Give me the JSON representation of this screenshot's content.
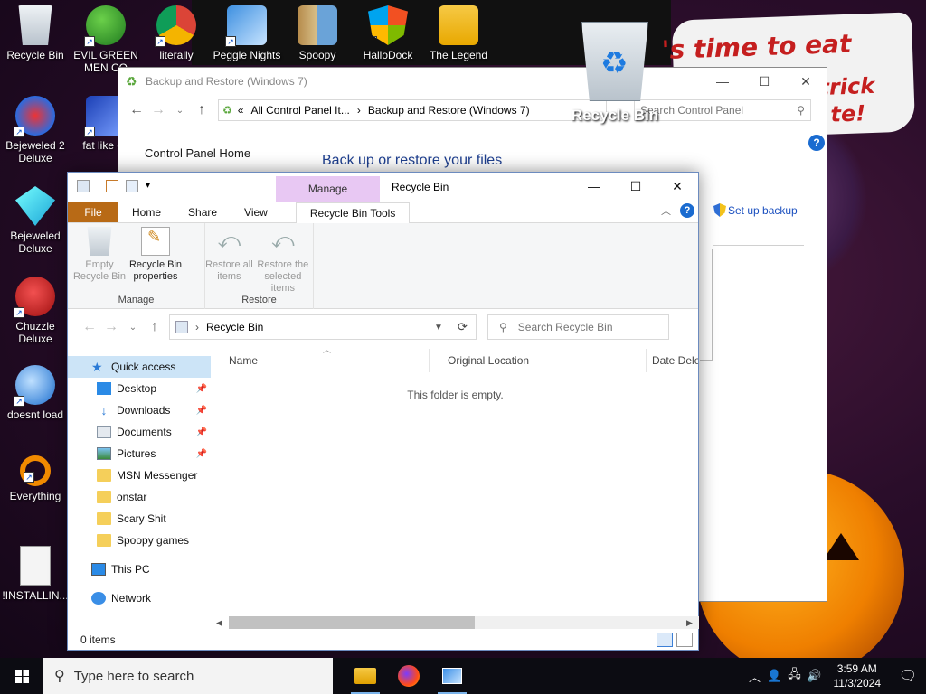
{
  "desktop": {
    "icons": [
      {
        "label": "Recycle Bin"
      },
      {
        "label": "EVIL GREEN MEN CO"
      },
      {
        "label": "literally"
      },
      {
        "label": "Peggle Nights"
      },
      {
        "label": "Spoopy"
      },
      {
        "label": "HalloDock"
      },
      {
        "label": "The Legend"
      },
      {
        "label": "Bejeweled 2 Deluxe"
      },
      {
        "label": "fat like da"
      },
      {
        "label": "Bejeweled Deluxe"
      },
      {
        "label": "Chuzzle Deluxe"
      },
      {
        "label": "doesnt load"
      },
      {
        "label": "Everything"
      },
      {
        "label": "!INSTALLIN..."
      }
    ],
    "wallpaper_text": [
      "'s time to eat shit",
      "trick",
      "te!"
    ],
    "big_recycle_label": "Recycle Bin"
  },
  "control_panel": {
    "title": "Backup and Restore (Windows 7)",
    "breadcrumb": [
      "«",
      "All Control Panel It...",
      "›",
      "Backup and Restore (Windows 7)"
    ],
    "search_placeholder": "Search Control Panel",
    "home_link": "Control Panel Home",
    "heading": "Back up or restore your files",
    "setup_backup": "Set up backup",
    "help": "?"
  },
  "explorer": {
    "title": "Recycle Bin",
    "context_tab": "Manage",
    "ribbon_tabs": [
      "File",
      "Home",
      "Share",
      "View",
      "Recycle Bin Tools"
    ],
    "help": "?",
    "ribbon_groups": [
      {
        "label": "Manage",
        "buttons": [
          "Empty Recycle Bin",
          "Recycle Bin properties"
        ]
      },
      {
        "label": "Restore",
        "buttons": [
          "Restore all items",
          "Restore the selected items"
        ]
      }
    ],
    "address": "Recycle Bin",
    "search_placeholder": "Search Recycle Bin",
    "nav": {
      "quick_access": "Quick access",
      "pinned": [
        "Desktop",
        "Downloads",
        "Documents",
        "Pictures"
      ],
      "folders": [
        "MSN Messenger",
        "onstar",
        "Scary Shit",
        "Spoopy games"
      ],
      "this_pc": "This PC",
      "network": "Network"
    },
    "columns": [
      "Name",
      "Original Location",
      "Date Dele"
    ],
    "empty_message": "This folder is empty.",
    "status": "0 items"
  },
  "taskbar": {
    "search_placeholder": "Type here to search",
    "time": "3:59 AM",
    "date": "11/3/2024"
  },
  "colors": {
    "file_tab": "#b86a16",
    "context_tab": "#e8c8f3",
    "selection": "#cce4f7",
    "link": "#1e3f8f"
  }
}
